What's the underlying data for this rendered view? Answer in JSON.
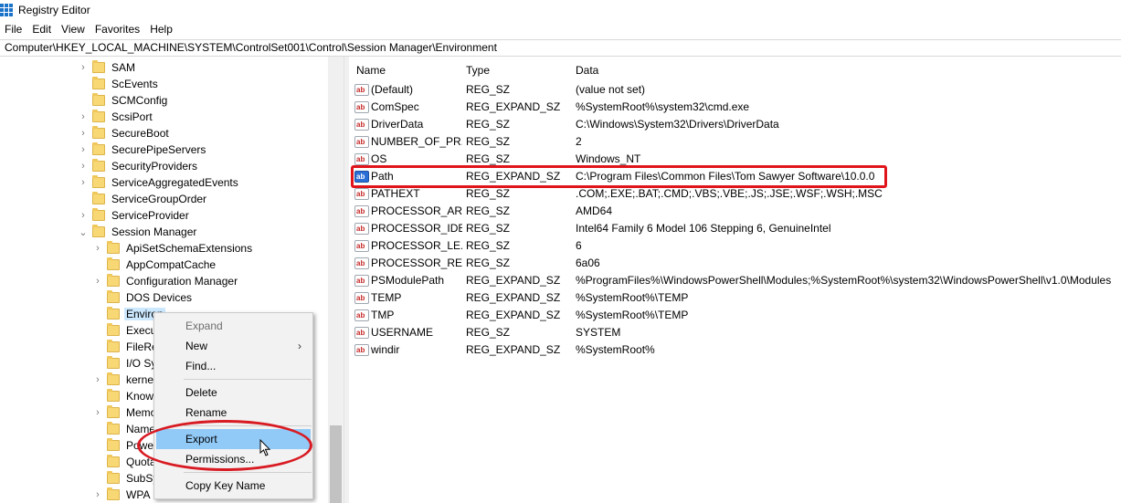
{
  "window": {
    "title": "Registry Editor"
  },
  "menu": [
    "File",
    "Edit",
    "View",
    "Favorites",
    "Help"
  ],
  "address": "Computer\\HKEY_LOCAL_MACHINE\\SYSTEM\\ControlSet001\\Control\\Session Manager\\Environment",
  "tree": [
    {
      "label": "SAM",
      "level": 1,
      "chevron": ">"
    },
    {
      "label": "ScEvents",
      "level": 1,
      "chevron": ""
    },
    {
      "label": "SCMConfig",
      "level": 1,
      "chevron": ""
    },
    {
      "label": "ScsiPort",
      "level": 1,
      "chevron": ">"
    },
    {
      "label": "SecureBoot",
      "level": 1,
      "chevron": ">"
    },
    {
      "label": "SecurePipeServers",
      "level": 1,
      "chevron": ">"
    },
    {
      "label": "SecurityProviders",
      "level": 1,
      "chevron": ">"
    },
    {
      "label": "ServiceAggregatedEvents",
      "level": 1,
      "chevron": ">"
    },
    {
      "label": "ServiceGroupOrder",
      "level": 1,
      "chevron": ""
    },
    {
      "label": "ServiceProvider",
      "level": 1,
      "chevron": ">"
    },
    {
      "label": "Session Manager",
      "level": 1,
      "chevron": "v"
    },
    {
      "label": "ApiSetSchemaExtensions",
      "level": 2,
      "chevron": ">"
    },
    {
      "label": "AppCompatCache",
      "level": 2,
      "chevron": ""
    },
    {
      "label": "Configuration Manager",
      "level": 2,
      "chevron": ">"
    },
    {
      "label": "DOS Devices",
      "level": 2,
      "chevron": ""
    },
    {
      "label": "Environ",
      "level": 2,
      "chevron": "",
      "selected": true
    },
    {
      "label": "Execu",
      "level": 2,
      "chevron": ""
    },
    {
      "label": "FileRe",
      "level": 2,
      "chevron": ""
    },
    {
      "label": "I/O Sy",
      "level": 2,
      "chevron": ""
    },
    {
      "label": "kernel",
      "level": 2,
      "chevron": ">"
    },
    {
      "label": "Know",
      "level": 2,
      "chevron": ""
    },
    {
      "label": "Memo",
      "level": 2,
      "chevron": ">"
    },
    {
      "label": "Name",
      "level": 2,
      "chevron": ""
    },
    {
      "label": "Power",
      "level": 2,
      "chevron": ""
    },
    {
      "label": "Quota",
      "level": 2,
      "chevron": ""
    },
    {
      "label": "SubSy",
      "level": 2,
      "chevron": ""
    },
    {
      "label": "WPA",
      "level": 2,
      "chevron": ">"
    }
  ],
  "columns": {
    "name": "Name",
    "type": "Type",
    "data": "Data"
  },
  "values": [
    {
      "name": "(Default)",
      "type": "REG_SZ",
      "data": "(value not set)"
    },
    {
      "name": "ComSpec",
      "type": "REG_EXPAND_SZ",
      "data": "%SystemRoot%\\system32\\cmd.exe"
    },
    {
      "name": "DriverData",
      "type": "REG_SZ",
      "data": "C:\\Windows\\System32\\Drivers\\DriverData"
    },
    {
      "name": "NUMBER_OF_PR...",
      "type": "REG_SZ",
      "data": "2"
    },
    {
      "name": "OS",
      "type": "REG_SZ",
      "data": "Windows_NT"
    },
    {
      "name": "Path",
      "type": "REG_EXPAND_SZ",
      "data": "C:\\Program Files\\Common Files\\Tom Sawyer Software\\10.0.0",
      "selected": true
    },
    {
      "name": "PATHEXT",
      "type": "REG_SZ",
      "data": ".COM;.EXE;.BAT;.CMD;.VBS;.VBE;.JS;.JSE;.WSF;.WSH;.MSC"
    },
    {
      "name": "PROCESSOR_AR...",
      "type": "REG_SZ",
      "data": "AMD64"
    },
    {
      "name": "PROCESSOR_IDE...",
      "type": "REG_SZ",
      "data": "Intel64 Family 6 Model 106 Stepping 6, GenuineIntel"
    },
    {
      "name": "PROCESSOR_LE...",
      "type": "REG_SZ",
      "data": "6"
    },
    {
      "name": "PROCESSOR_RE...",
      "type": "REG_SZ",
      "data": "6a06"
    },
    {
      "name": "PSModulePath",
      "type": "REG_EXPAND_SZ",
      "data": "%ProgramFiles%\\WindowsPowerShell\\Modules;%SystemRoot%\\system32\\WindowsPowerShell\\v1.0\\Modules"
    },
    {
      "name": "TEMP",
      "type": "REG_EXPAND_SZ",
      "data": "%SystemRoot%\\TEMP"
    },
    {
      "name": "TMP",
      "type": "REG_EXPAND_SZ",
      "data": "%SystemRoot%\\TEMP"
    },
    {
      "name": "USERNAME",
      "type": "REG_SZ",
      "data": "SYSTEM"
    },
    {
      "name": "windir",
      "type": "REG_EXPAND_SZ",
      "data": "%SystemRoot%"
    }
  ],
  "context_menu": {
    "expand": "Expand",
    "new": "New",
    "find": "Find...",
    "delete": "Delete",
    "rename": "Rename",
    "export": "Export",
    "permissions": "Permissions...",
    "copy_key_name": "Copy Key Name"
  },
  "colors": {
    "highlight_red": "#e0151b",
    "menu_hover": "#91c9f7",
    "tree_selected": "#cce8ff"
  }
}
